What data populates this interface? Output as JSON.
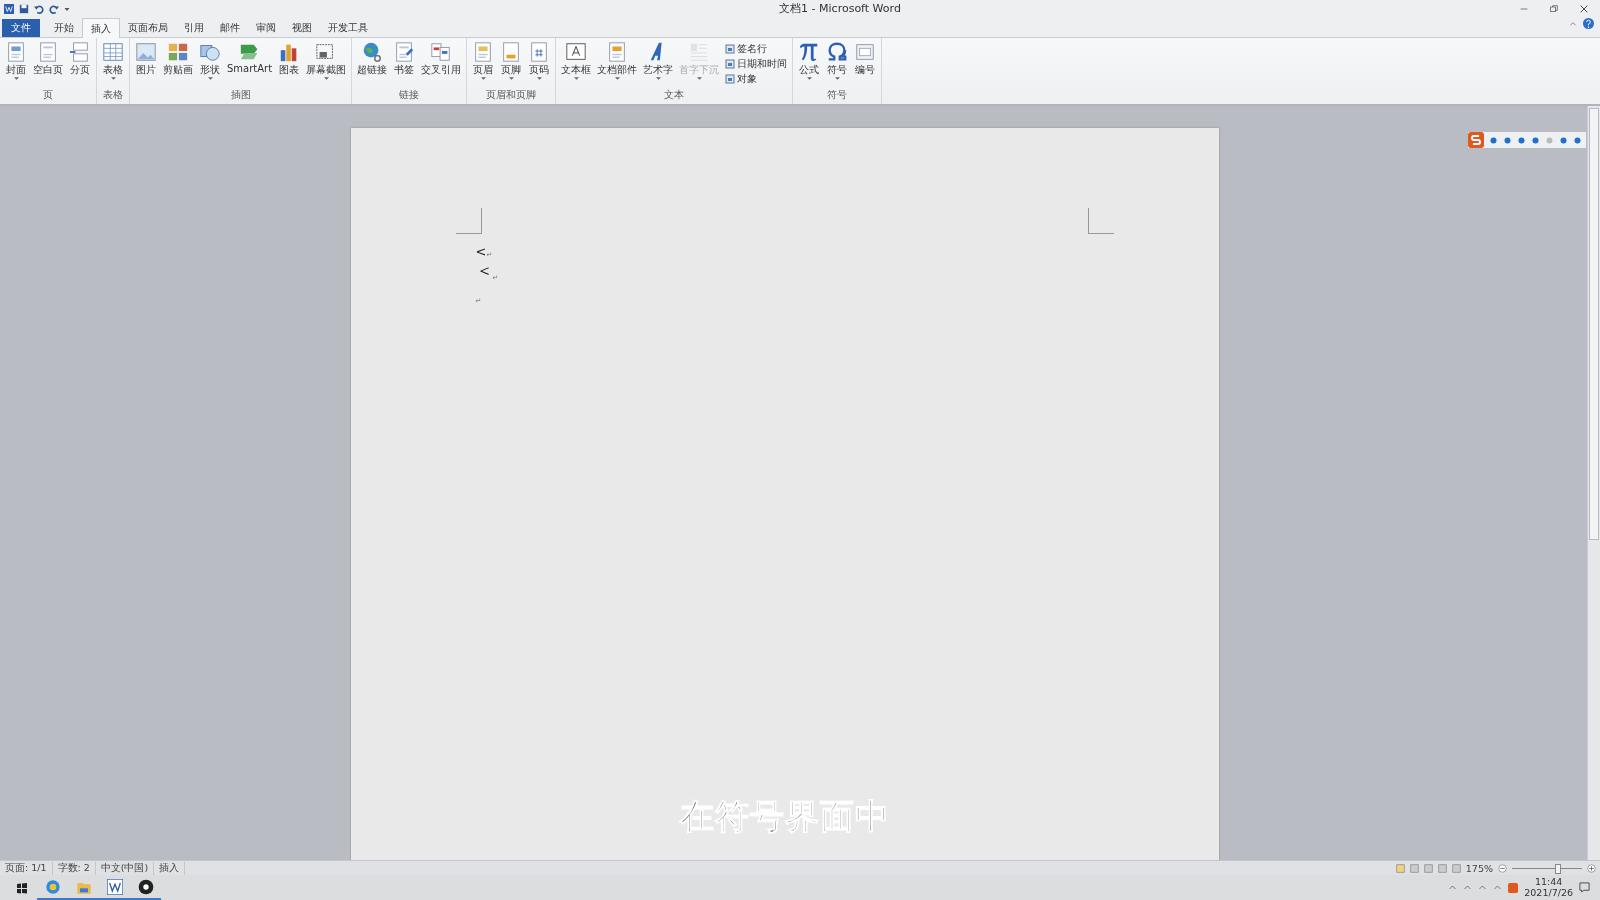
{
  "window": {
    "title": "文档1 - Microsoft Word"
  },
  "tabs": [
    {
      "label": "文件",
      "kind": "file",
      "selected": false
    },
    {
      "label": "开始",
      "kind": "tab",
      "selected": false
    },
    {
      "label": "插入",
      "kind": "tab",
      "selected": true
    },
    {
      "label": "页面布局",
      "kind": "tab",
      "selected": false
    },
    {
      "label": "引用",
      "kind": "tab",
      "selected": false
    },
    {
      "label": "邮件",
      "kind": "tab",
      "selected": false
    },
    {
      "label": "审阅",
      "kind": "tab",
      "selected": false
    },
    {
      "label": "视图",
      "kind": "tab",
      "selected": false
    },
    {
      "label": "开发工具",
      "kind": "tab",
      "selected": false
    }
  ],
  "ribbon_groups": [
    {
      "label": "页",
      "items": [
        {
          "label": "封面",
          "dropdown": true,
          "disabled": false
        },
        {
          "label": "空白页",
          "dropdown": false,
          "disabled": false
        },
        {
          "label": "分页",
          "dropdown": false,
          "disabled": false
        }
      ]
    },
    {
      "label": "表格",
      "items": [
        {
          "label": "表格",
          "dropdown": true,
          "disabled": false
        }
      ]
    },
    {
      "label": "插图",
      "items": [
        {
          "label": "图片",
          "dropdown": false,
          "disabled": false
        },
        {
          "label": "剪贴画",
          "dropdown": false,
          "disabled": false
        },
        {
          "label": "形状",
          "dropdown": true,
          "disabled": false
        },
        {
          "label": "SmartArt",
          "dropdown": false,
          "disabled": false
        },
        {
          "label": "图表",
          "dropdown": false,
          "disabled": false
        },
        {
          "label": "屏幕截图",
          "dropdown": true,
          "disabled": false
        }
      ]
    },
    {
      "label": "链接",
      "items": [
        {
          "label": "超链接",
          "dropdown": false,
          "disabled": false
        },
        {
          "label": "书签",
          "dropdown": false,
          "disabled": false
        },
        {
          "label": "交叉引用",
          "dropdown": false,
          "disabled": false
        }
      ]
    },
    {
      "label": "页眉和页脚",
      "items": [
        {
          "label": "页眉",
          "dropdown": true,
          "disabled": false
        },
        {
          "label": "页脚",
          "dropdown": true,
          "disabled": false
        },
        {
          "label": "页码",
          "dropdown": true,
          "disabled": false
        }
      ]
    },
    {
      "label": "文本",
      "items": [
        {
          "label": "文本框",
          "dropdown": true,
          "disabled": false
        },
        {
          "label": "文档部件",
          "dropdown": true,
          "disabled": false
        },
        {
          "label": "艺术字",
          "dropdown": true,
          "disabled": false
        },
        {
          "label": "首字下沉",
          "dropdown": true,
          "disabled": true
        }
      ],
      "small_items": [
        {
          "label": "签名行"
        },
        {
          "label": "日期和时间"
        },
        {
          "label": "对象"
        }
      ]
    },
    {
      "label": "符号",
      "items": [
        {
          "label": "公式",
          "dropdown": true,
          "disabled": false
        },
        {
          "label": "符号",
          "dropdown": true,
          "disabled": false
        },
        {
          "label": "编号",
          "dropdown": false,
          "disabled": false
        }
      ]
    }
  ],
  "document": {
    "paragraphs": [
      {
        "text": "<",
        "mark": "↵"
      },
      {
        "text": "＜",
        "mark": "↵"
      },
      {
        "mark": "↵"
      }
    ]
  },
  "caption": "在符号界面中",
  "status_bar": {
    "items": [
      "页面: 1/1",
      "字数: 2",
      "中文(中国)",
      "插入"
    ],
    "zoom": "175%",
    "zoom_level": {
      "level": 0.62
    }
  },
  "taskbar": {
    "time": "11:44",
    "date": "2021/7/26"
  }
}
